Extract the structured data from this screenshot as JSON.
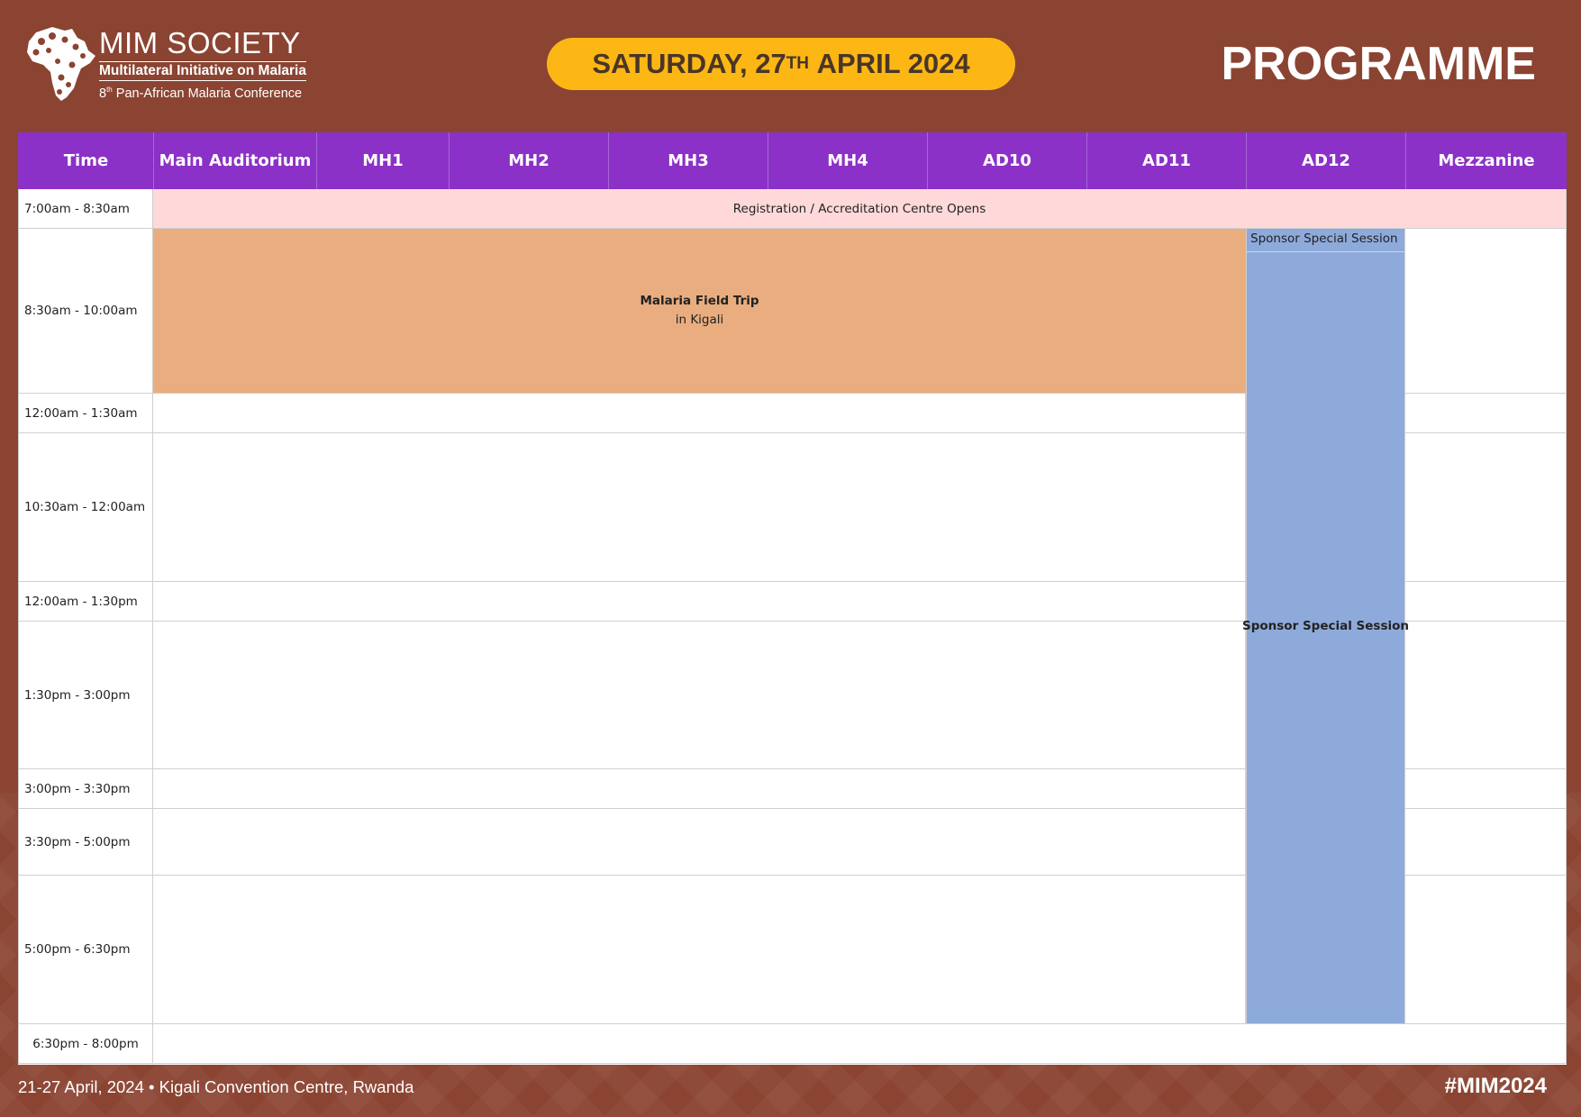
{
  "logo": {
    "title": "MIM SOCIETY",
    "subtitle": "Multilateral Initiative on Malaria",
    "conference_num": "8",
    "conference_sup": "th",
    "conference_rest": "Pan-African Malaria Conference"
  },
  "date_pill": {
    "before_sup": "SATURDAY, 27",
    "sup": "TH",
    "after_sup": "APRIL 2024"
  },
  "page_title": "PROGRAMME",
  "table": {
    "headers": [
      "Time",
      "Main Auditorium",
      "MH1",
      "MH2",
      "MH3",
      "MH4",
      "AD10",
      "AD11",
      "AD12",
      "Mezzanine"
    ],
    "times": [
      "7:00am - 8:30am",
      "8:30am - 10:00am",
      "12:00am - 1:30am",
      "10:30am - 12:00am",
      "12:00am - 1:30pm",
      "1:30pm - 3:00pm",
      "3:00pm - 3:30pm",
      "3:30pm - 5:00pm",
      "5:00pm - 6:30pm",
      "6:30pm - 8:00pm"
    ],
    "registration": "Registration / Accreditation Centre Opens",
    "field_trip": {
      "title": "Malaria Field Trip",
      "subtitle": "in Kigali"
    },
    "sponsor_top": "Sponsor Special Session",
    "sponsor_main": "Sponsor Special Session"
  },
  "footer": {
    "left": "21-27 April, 2024 • Kigali Convention Centre, Rwanda",
    "right": "#MIM2024"
  },
  "colors": {
    "background": "#8b4432",
    "header_purple": "#8b31c7",
    "date_pill": "#fcb714",
    "registration": "#ffd9d9",
    "field_trip": "#e9ad7f",
    "sponsor": "#8eaadb"
  }
}
